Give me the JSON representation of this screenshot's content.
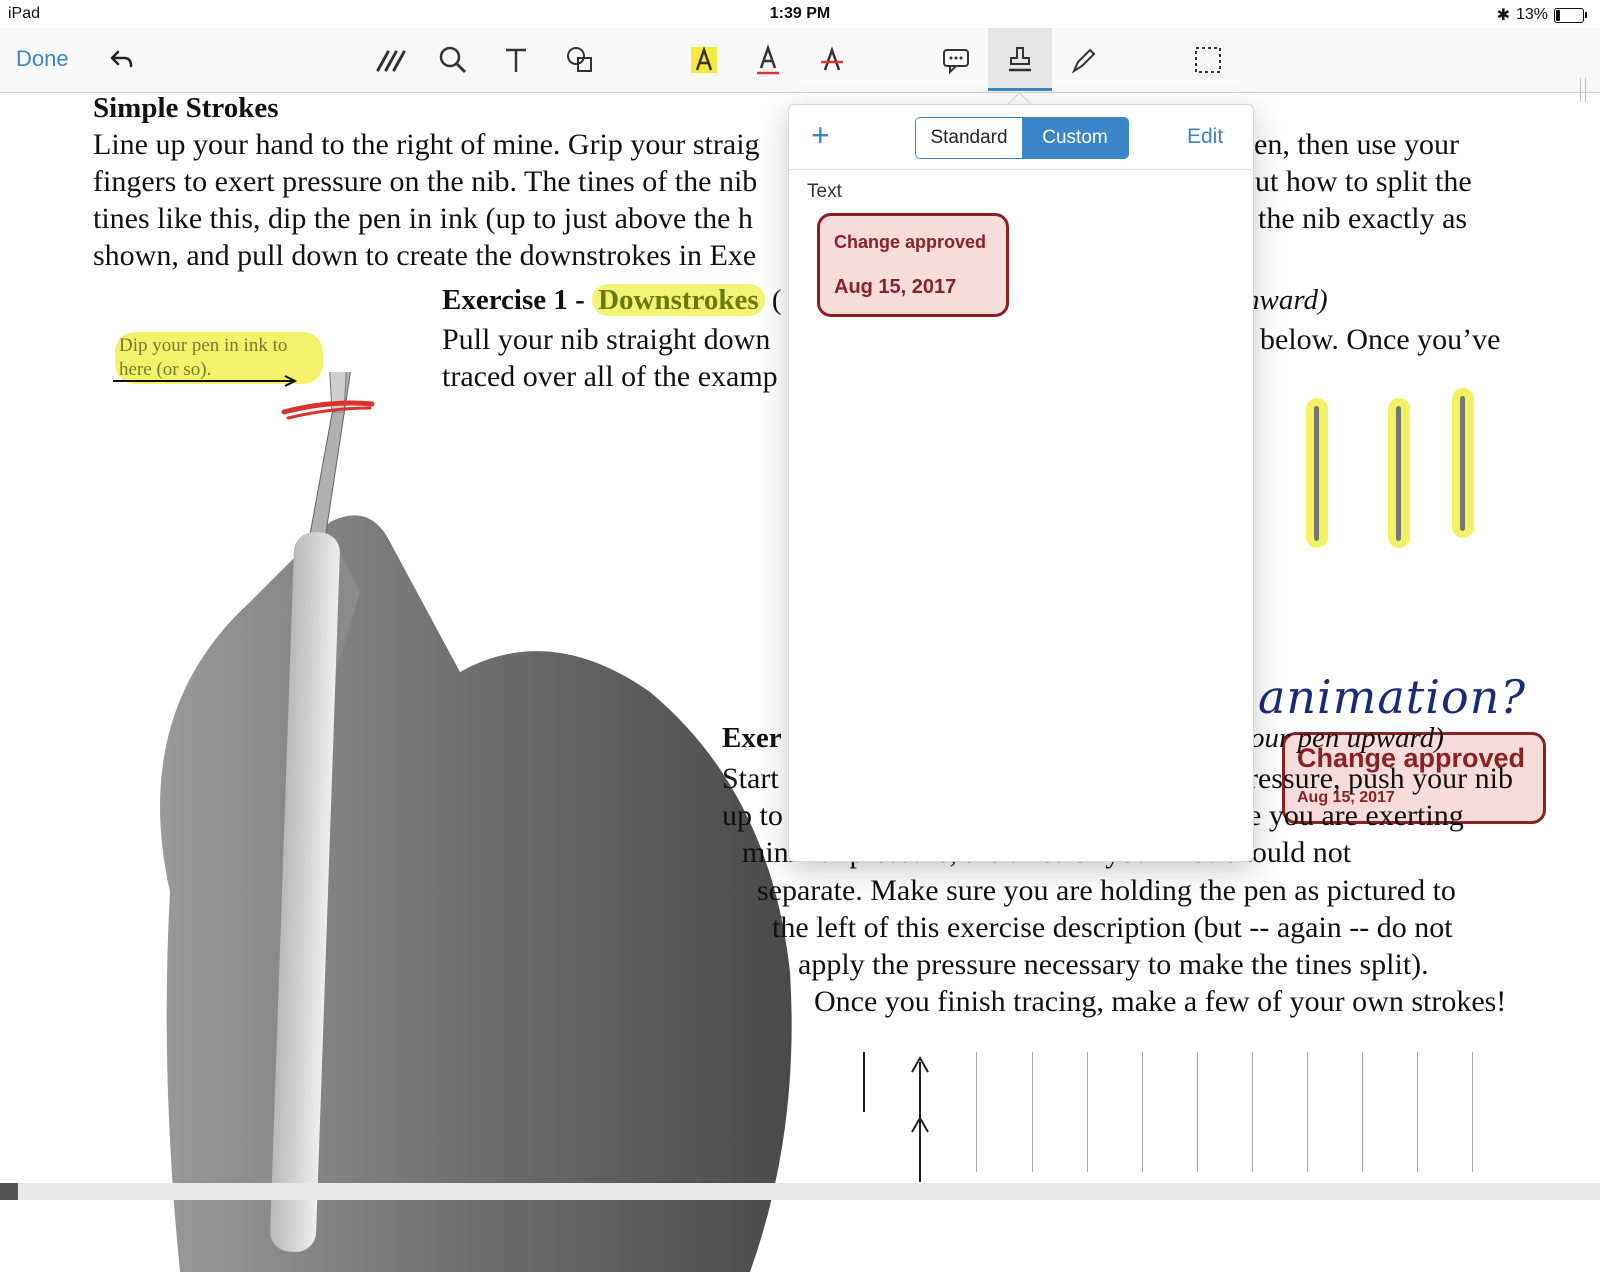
{
  "status": {
    "device": "iPad",
    "time": "1:39 PM",
    "battery": "13%"
  },
  "toolbar": {
    "done_label": "Done",
    "icons": [
      "undo-icon",
      "pencils-icon",
      "zoom-icon",
      "text-tool-icon",
      "shapes-icon",
      "highlight-text-icon",
      "underline-text-icon",
      "strikethrough-text-icon",
      "comment-icon",
      "stamp-icon",
      "signature-icon",
      "selection-icon"
    ],
    "accent": "#3a86c8"
  },
  "document": {
    "heading": "Simple Strokes",
    "para1": [
      "Line up your hand to the right of mine. Grip your straig",
      "en, then use your",
      "fingers to exert pressure on the nib. The tines of the nib",
      "out how to split the",
      "tines like this, dip the pen in ink (up to just above the h",
      "the nib exactly as",
      "shown, and pull down to create the downstrokes in Exe"
    ],
    "dip_note": "Dip your pen in ink to here (or so).",
    "ex1_prefix": "Exercise 1 - ",
    "ex1_highlight": "Downstrokes",
    "ex1_paren": " (",
    "ex1_right": "nward)",
    "para2_l1": "Pull your nib straight down",
    "para2_r1": "below. Once you’ve",
    "para2_l2": "traced over all of the examp",
    "handwriting": "animation?",
    "ex2_left": "Exer",
    "ex2_right": "our pen upward)",
    "ex2_l2": "Start",
    "ex2_r2": "ressure, push your nib",
    "ex2_l3": "up to",
    "ex2_r3": "e you are exerting",
    "ex2_l4": "minimal pressure, the tines of your nibs should not",
    "ex2_l5": "separate. Make sure you are holding the pen as pictured to",
    "ex2_l6": "the left of this exercise description (but -- again -- do not",
    "ex2_l7": "apply the pressure necessary to make the tines split).",
    "ex2_l8": "Once you finish tracing, make a few of your own strokes!",
    "stamp_title": "Change approved",
    "stamp_date": "Aug 15, 2017"
  },
  "popover": {
    "add_label": "+",
    "segments": [
      "Standard",
      "Custom"
    ],
    "selected_segment": "Custom",
    "edit_label": "Edit",
    "section_label": "Text",
    "stamp_title": "Change approved",
    "stamp_date": "Aug 15, 2017"
  }
}
